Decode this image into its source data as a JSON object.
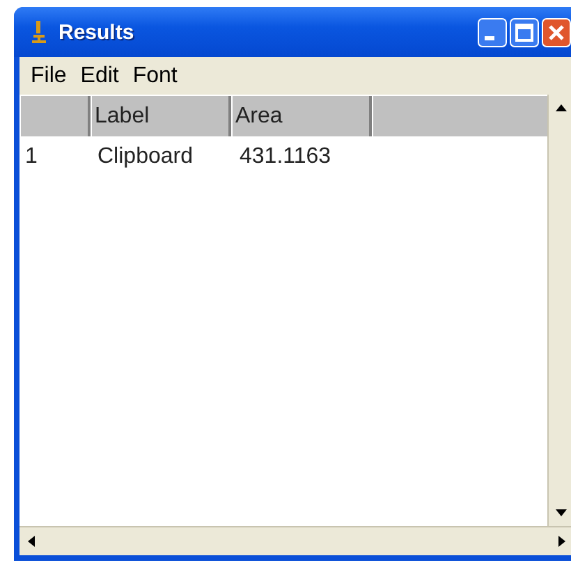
{
  "window": {
    "title": "Results"
  },
  "menu": [
    "File",
    "Edit",
    "Font"
  ],
  "table": {
    "columns": [
      "",
      "Label",
      "Area",
      ""
    ],
    "rows": [
      [
        "1",
        "Clipboard",
        "431.1163"
      ]
    ]
  }
}
